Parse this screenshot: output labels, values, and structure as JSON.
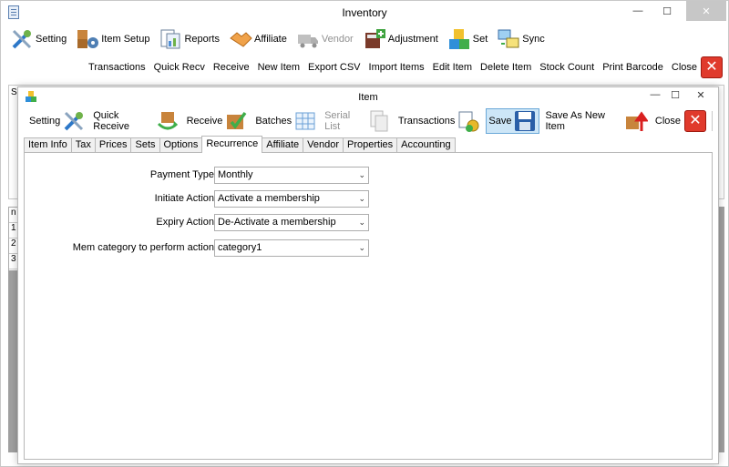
{
  "main_window": {
    "title": "Inventory",
    "controls": {
      "minimize": "—",
      "maximize": "☐",
      "close": "✕"
    },
    "toolbar": [
      {
        "label": "Setting",
        "icon": "wrench-screwdriver-icon",
        "disabled": false
      },
      {
        "label": "Item Setup",
        "icon": "boxes-gear-icon",
        "disabled": false
      },
      {
        "label": "Reports",
        "icon": "reports-icon",
        "disabled": false
      },
      {
        "label": "Affiliate",
        "icon": "handshake-icon",
        "disabled": false
      },
      {
        "label": "Vendor",
        "icon": "truck-icon",
        "disabled": true
      },
      {
        "label": "Adjustment",
        "icon": "calculator-icon",
        "disabled": false
      },
      {
        "label": "Set",
        "icon": "blocks-icon",
        "disabled": false
      },
      {
        "label": "Sync",
        "icon": "sync-screens-icon",
        "disabled": false
      }
    ],
    "actions": [
      "Transactions",
      "Quick Recv",
      "Receive",
      "New Item",
      "Export CSV",
      "Import Items",
      "Edit Item",
      "Delete Item",
      "Stock Count",
      "Print Barcode",
      "Close"
    ],
    "grid_rows": [
      "n",
      "1",
      "2",
      "3"
    ],
    "panel_label": "S"
  },
  "item_window": {
    "title": "Item",
    "controls": {
      "minimize": "—",
      "maximize": "☐",
      "close": "✕"
    },
    "toolbar": [
      {
        "label": "Setting",
        "icon": "wrench-screwdriver-icon",
        "disabled": false
      },
      {
        "label": "Quick Receive",
        "icon": "box-arrow-icon",
        "disabled": false
      },
      {
        "label": "Receive",
        "icon": "box-check-icon",
        "disabled": false
      },
      {
        "label": "Batches",
        "icon": "grid-icon",
        "disabled": false
      },
      {
        "label": "Serial List",
        "icon": "serial-list-icon",
        "disabled": true
      },
      {
        "label": "Transactions",
        "icon": "coins-icon",
        "disabled": false
      },
      {
        "label": "Save",
        "icon": "floppy-disk-icon",
        "disabled": false,
        "active": true
      },
      {
        "label": "Save As New Item",
        "icon": "box-up-arrow-icon",
        "disabled": false
      },
      {
        "label": "Close",
        "icon": "close-x-icon",
        "disabled": false
      }
    ],
    "tabs": [
      "Item Info",
      "Tax",
      "Prices",
      "Sets",
      "Options",
      "Recurrence",
      "Affiliate",
      "Vendor",
      "Properties",
      "Accounting"
    ],
    "active_tab": "Recurrence",
    "form": [
      {
        "label": "Payment Type",
        "value": "Monthly"
      },
      {
        "label": "Initiate Action",
        "value": "Activate a membership"
      },
      {
        "label": "Expiry Action",
        "value": "De-Activate a membership"
      },
      {
        "label": "Mem category to perform action",
        "value": "category1"
      }
    ]
  },
  "colors": {
    "close_red": "#e03a2c",
    "save_highlight": "#cde6f7"
  }
}
